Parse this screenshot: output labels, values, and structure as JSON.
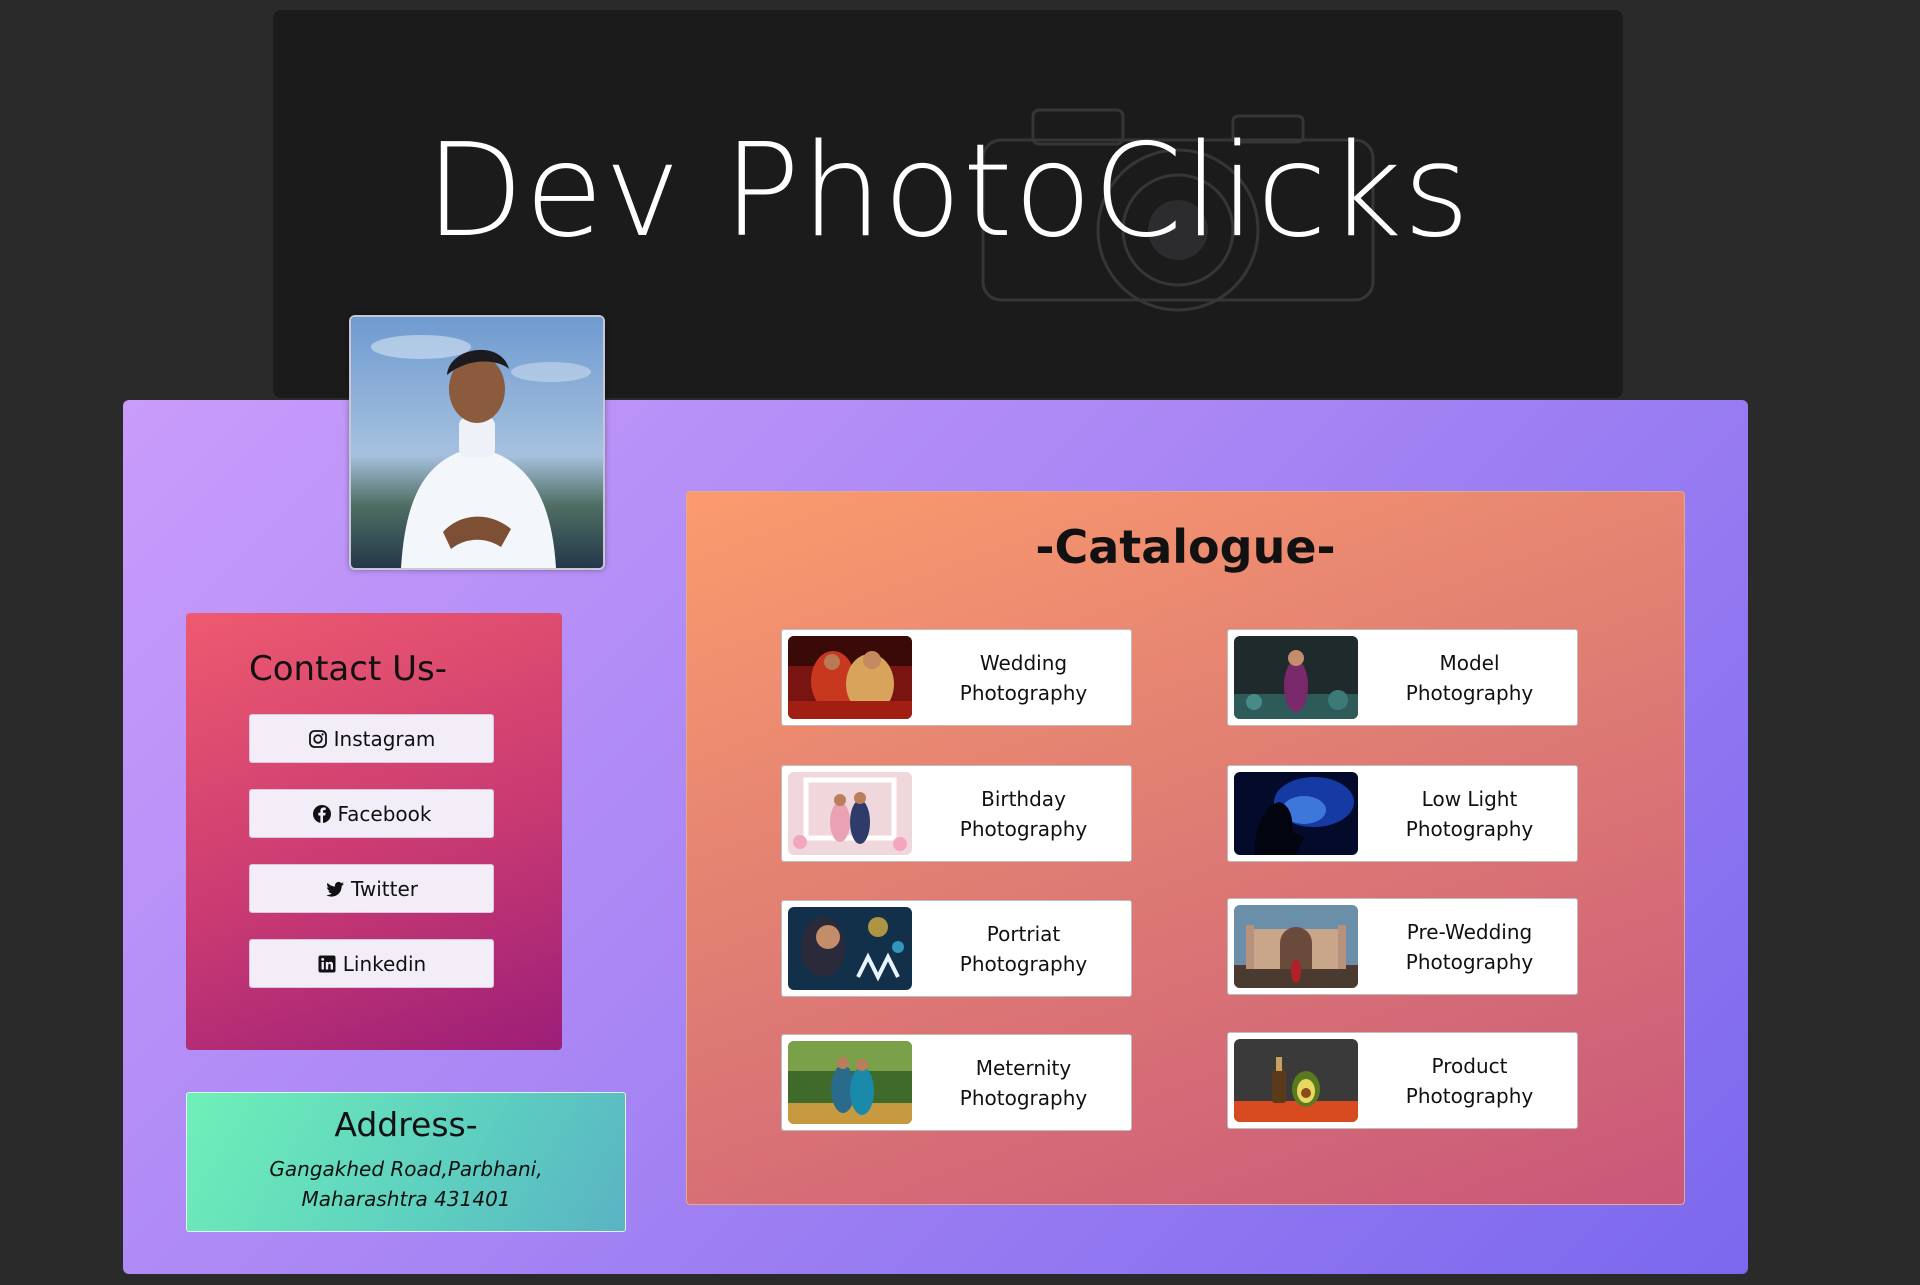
{
  "header": {
    "title": "Dev PhotoClicks"
  },
  "profile": {
    "avatar_icon": "person-portrait-photo"
  },
  "contact": {
    "title": "Contact Us-",
    "links": [
      {
        "label": "Instagram",
        "icon": "instagram-icon"
      },
      {
        "label": "Facebook",
        "icon": "facebook-icon"
      },
      {
        "label": "Twitter",
        "icon": "twitter-icon"
      },
      {
        "label": "Linkedin",
        "icon": "linkedin-icon"
      }
    ]
  },
  "address": {
    "title": "Address-",
    "line1": "Gangakhed Road,Parbhani,",
    "line2": "Maharashtra 431401"
  },
  "catalogue": {
    "title": "-Catalogue-",
    "items": [
      {
        "line1": "Wedding",
        "line2": "Photography"
      },
      {
        "line1": "Model",
        "line2": "Photography"
      },
      {
        "line1": "Birthday",
        "line2": "Photography"
      },
      {
        "line1": "Low Light",
        "line2": "Photography"
      },
      {
        "line1": "Portriat",
        "line2": "Photography"
      },
      {
        "line1": "Pre-Wedding",
        "line2": "Photography"
      },
      {
        "line1": "Meternity",
        "line2": "Photography"
      },
      {
        "line1": "Product",
        "line2": "Photography"
      }
    ]
  },
  "colors": {
    "page_bg": "#2a2a2a",
    "banner_bg": "#1b1b1c",
    "panel_gradient_start": "#c99cfb",
    "panel_gradient_end": "#7b68ee",
    "contact_gradient_start": "#ee5a6f",
    "contact_gradient_end": "#9c1e78",
    "address_gradient_start": "#6ff0b8",
    "catalogue_gradient_start": "#fb9b6d",
    "catalogue_gradient_end": "#c9577a"
  }
}
